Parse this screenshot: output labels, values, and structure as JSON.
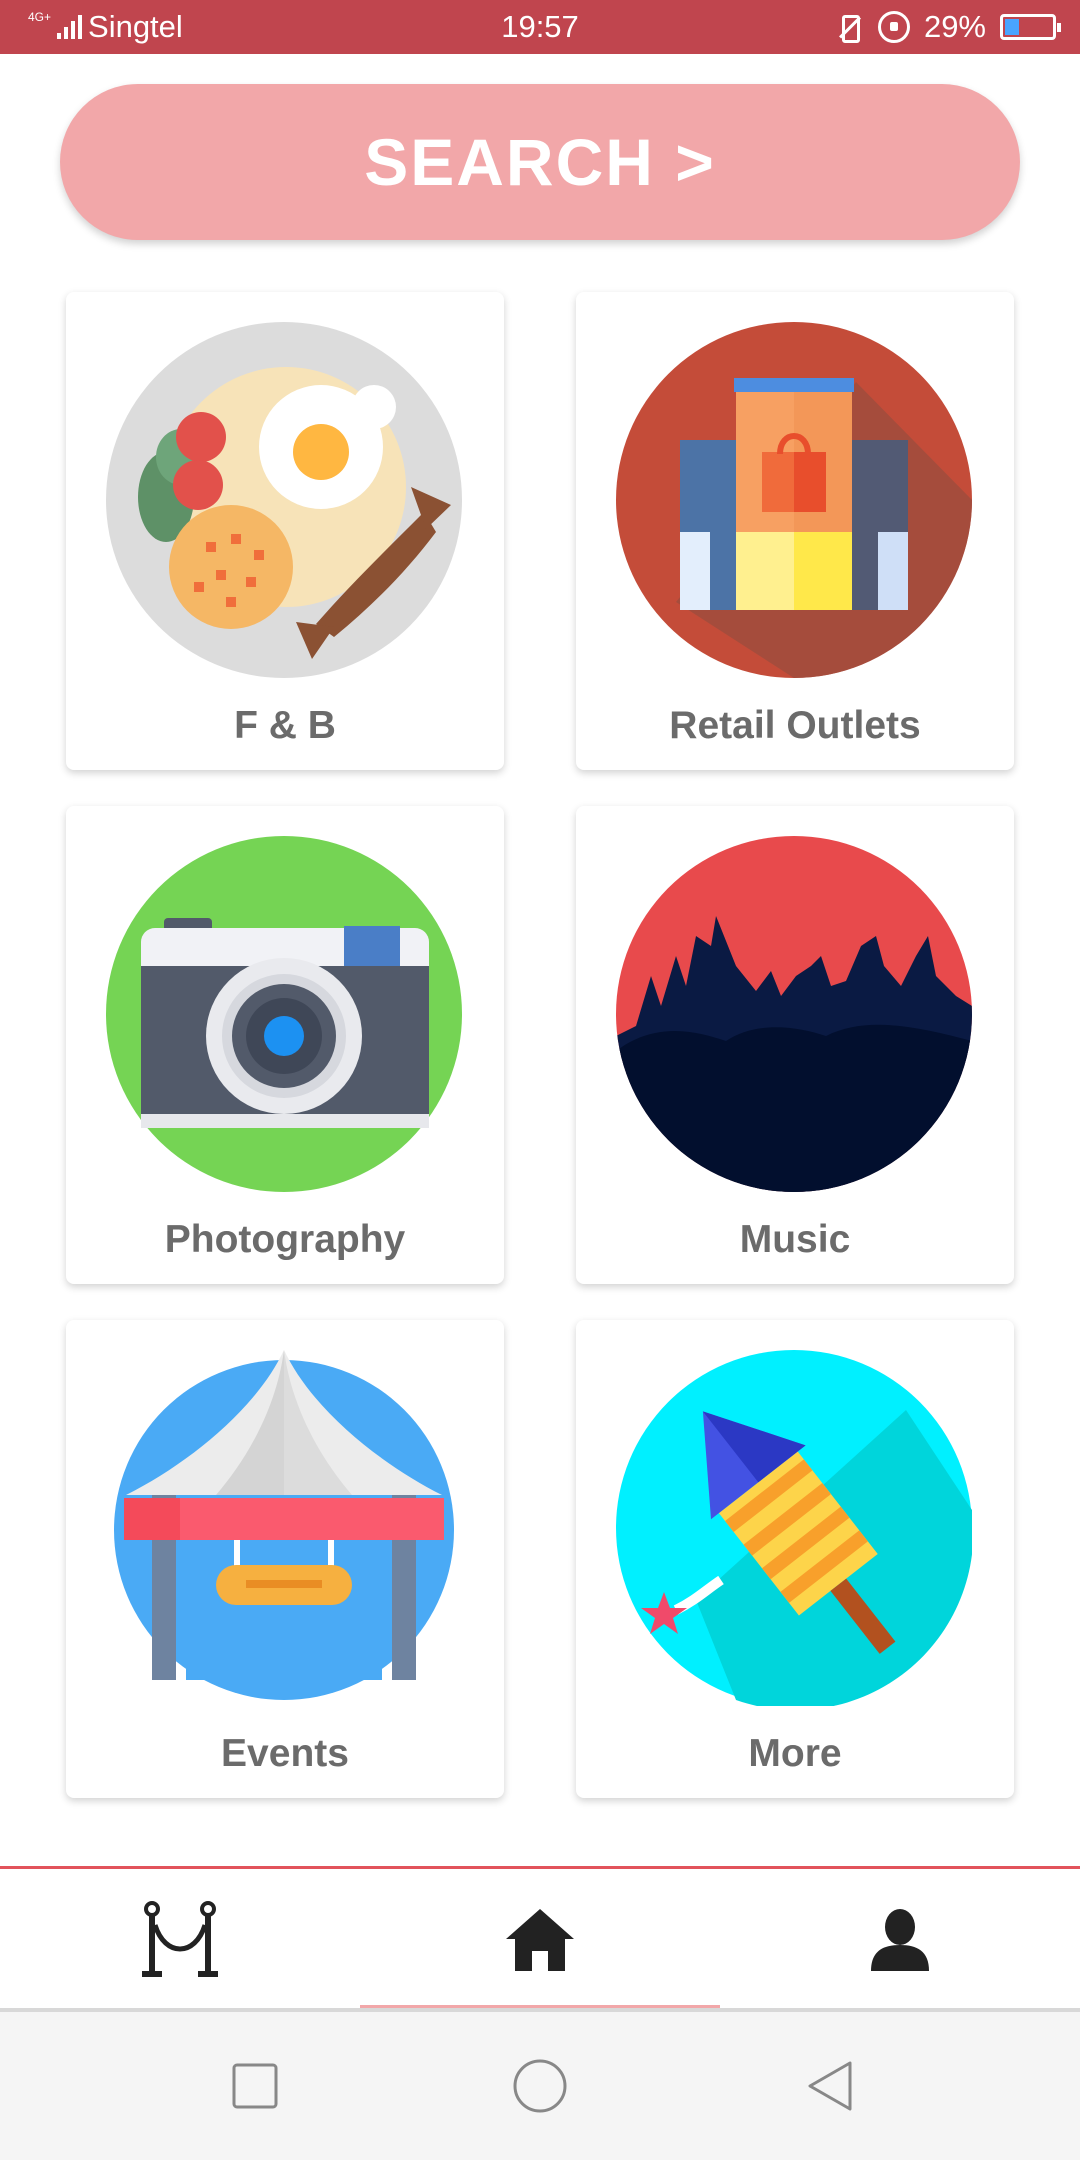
{
  "status_bar": {
    "network": "4G+",
    "carrier": "Singtel",
    "time": "19:57",
    "battery": "29%"
  },
  "search": {
    "label": "SEARCH >"
  },
  "categories": [
    {
      "label": "F & B",
      "icon": "food-plate-icon"
    },
    {
      "label": "Retail Outlets",
      "icon": "shopping-building-icon"
    },
    {
      "label": "Photography",
      "icon": "camera-icon"
    },
    {
      "label": "Music",
      "icon": "concert-crowd-icon"
    },
    {
      "label": "Events",
      "icon": "event-tent-icon"
    },
    {
      "label": "More",
      "icon": "firework-rocket-icon"
    }
  ],
  "tabs": [
    {
      "icon": "stanchion-rope-icon"
    },
    {
      "icon": "home-icon",
      "active": true
    },
    {
      "icon": "profile-icon"
    }
  ],
  "colors": {
    "status_bar": "#c0454e",
    "search_button": "#f2a7a9",
    "tab_bar_top_border": "#e2535b",
    "label_text": "#6b6b6b"
  }
}
